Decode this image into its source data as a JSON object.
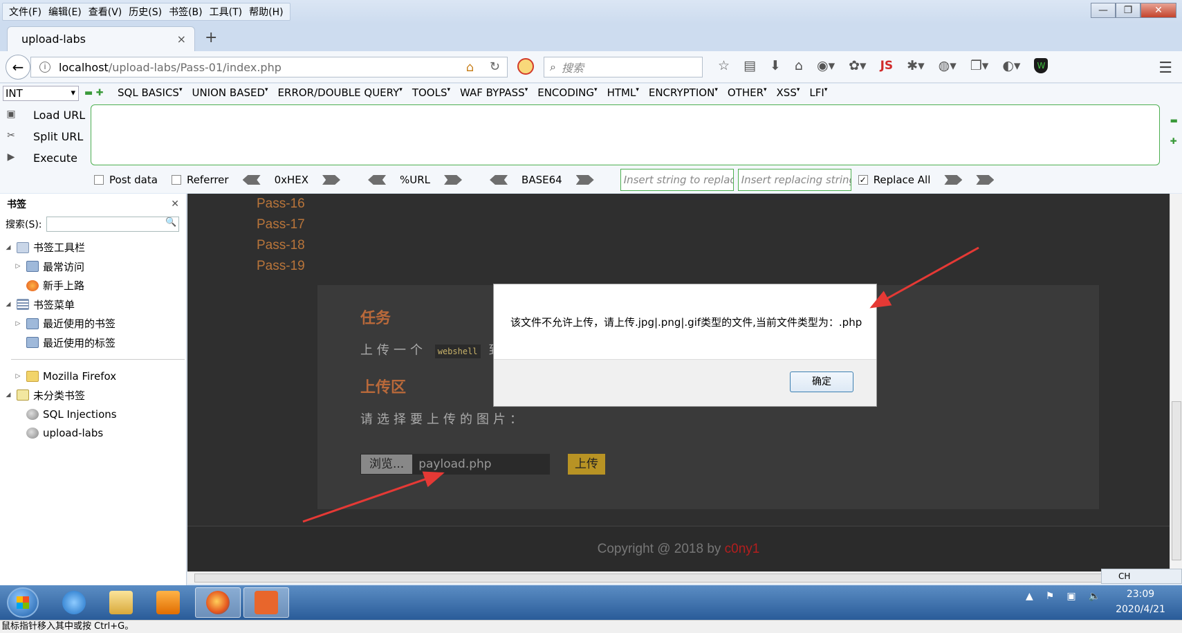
{
  "menubar": {
    "items": [
      "文件(F)",
      "编辑(E)",
      "查看(V)",
      "历史(S)",
      "书签(B)",
      "工具(T)",
      "帮助(H)"
    ],
    "window_buttons": [
      "—",
      "❐",
      "✕"
    ]
  },
  "tab": {
    "title": "upload-labs",
    "close": "×",
    "new": "+"
  },
  "navbar": {
    "url_host": "localhost",
    "url_path": "/upload-labs/Pass-01/index.php",
    "search_placeholder": "搜索",
    "js_label": "JS"
  },
  "hackbar": {
    "select_value": "INT",
    "menus": [
      "SQL BASICS",
      "UNION BASED",
      "ERROR/DOUBLE QUERY",
      "TOOLS",
      "WAF BYPASS",
      "ENCODING",
      "HTML",
      "ENCRYPTION",
      "OTHER",
      "XSS",
      "LFI"
    ],
    "actions": [
      "Load URL",
      "Split URL",
      "Execute"
    ],
    "textarea_value": "",
    "post_data_label": "Post data",
    "referrer_label": "Referrer",
    "hex_label": "0xHEX",
    "url_label": "%URL",
    "base64_label": "BASE64",
    "insert_placeholder": "Insert string to replace",
    "replacing_placeholder": "Insert replacing string",
    "replace_all_label": "Replace All",
    "replace_all_checked": true
  },
  "sidebar": {
    "title": "书签",
    "search_label": "搜索(S):",
    "tree": [
      {
        "label": "书签工具栏",
        "level": 0,
        "twisty": "◢",
        "icon": "star"
      },
      {
        "label": "最常访问",
        "level": 1,
        "twisty": "▷",
        "icon": "mag"
      },
      {
        "label": "新手上路",
        "level": 1,
        "twisty": "",
        "icon": "fox"
      },
      {
        "label": "书签菜单",
        "level": 0,
        "twisty": "◢",
        "icon": "list"
      },
      {
        "label": "最近使用的书签",
        "level": 1,
        "twisty": "▷",
        "icon": "mag"
      },
      {
        "label": "最近使用的标签",
        "level": 1,
        "twisty": "",
        "icon": "mag"
      },
      {
        "label": "Mozilla Firefox",
        "level": 1,
        "twisty": "▷",
        "icon": "folder"
      },
      {
        "label": "未分类书签",
        "level": 0,
        "twisty": "◢",
        "icon": "uncat"
      },
      {
        "label": "SQL Injections",
        "level": 1,
        "twisty": "",
        "icon": "globe"
      },
      {
        "label": "upload-labs",
        "level": 1,
        "twisty": "",
        "icon": "globe"
      }
    ]
  },
  "page": {
    "passes": [
      "Pass-16",
      "Pass-17",
      "Pass-18",
      "Pass-19"
    ],
    "task_heading": "任务",
    "task_text_before": "上传一个",
    "task_code": "webshell",
    "task_text_after": "到",
    "upload_heading": "上传区",
    "choose_text": "请选择要上传的图片：",
    "browse_label": "浏览...",
    "file_name": "payload.php",
    "upload_button": "上传",
    "footer_text": "Copyright @ 2018 by ",
    "footer_author": "c0ny1"
  },
  "dialog": {
    "message": "该文件不允许上传，请上传.jpg|.png|.gif类型的文件,当前文件类型为：.php",
    "ok_label": "确定"
  },
  "taskbar": {
    "clock_time": "23:09",
    "clock_date": "2020/4/21",
    "lang": "CH"
  },
  "statusbar": {
    "text": "鼠标指针移入其中或按 Ctrl+G。"
  },
  "colors": {
    "accent_red": "#e53935",
    "pass_link": "#b9753a",
    "upload_button": "#b89324"
  }
}
